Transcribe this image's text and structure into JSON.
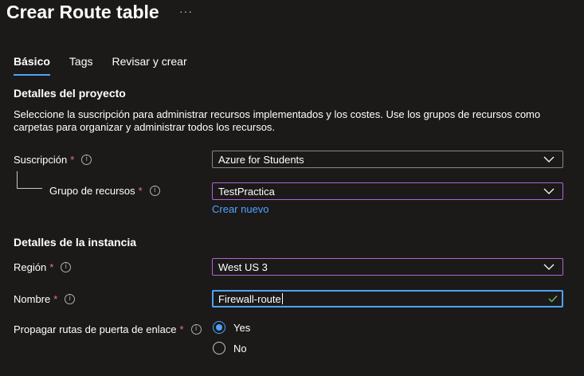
{
  "header": {
    "title": "Crear Route table",
    "more": "···"
  },
  "tabs": [
    {
      "label": "Básico",
      "active": true
    },
    {
      "label": "Tags",
      "active": false
    },
    {
      "label": "Revisar y crear",
      "active": false
    }
  ],
  "project": {
    "heading": "Detalles del proyecto",
    "description": "Seleccione la suscripción para administrar recursos implementados y los costes. Use los grupos de recursos como carpetas para organizar y administrar todos los recursos.",
    "subscription_label": "Suscripción",
    "subscription_value": "Azure for Students",
    "resource_group_label": "Grupo de recursos",
    "resource_group_value": "TestPractica",
    "create_new_link": "Crear nuevo"
  },
  "instance": {
    "heading": "Detalles de la instancia",
    "region_label": "Región",
    "region_value": "West US 3",
    "name_label": "Nombre",
    "name_value": "Firewall-route",
    "propagate_label": "Propagar rutas de puerta de enlace",
    "propagate_options": [
      {
        "label": "Yes",
        "selected": true
      },
      {
        "label": "No",
        "selected": false
      }
    ]
  },
  "common": {
    "required_mark": "*",
    "info_glyph": "i"
  },
  "colors": {
    "background": "#1b1a19",
    "accent": "#4da3ff",
    "focus_purple": "#b164d6",
    "required": "#f1707b",
    "valid_check": "#6ccb5f"
  }
}
